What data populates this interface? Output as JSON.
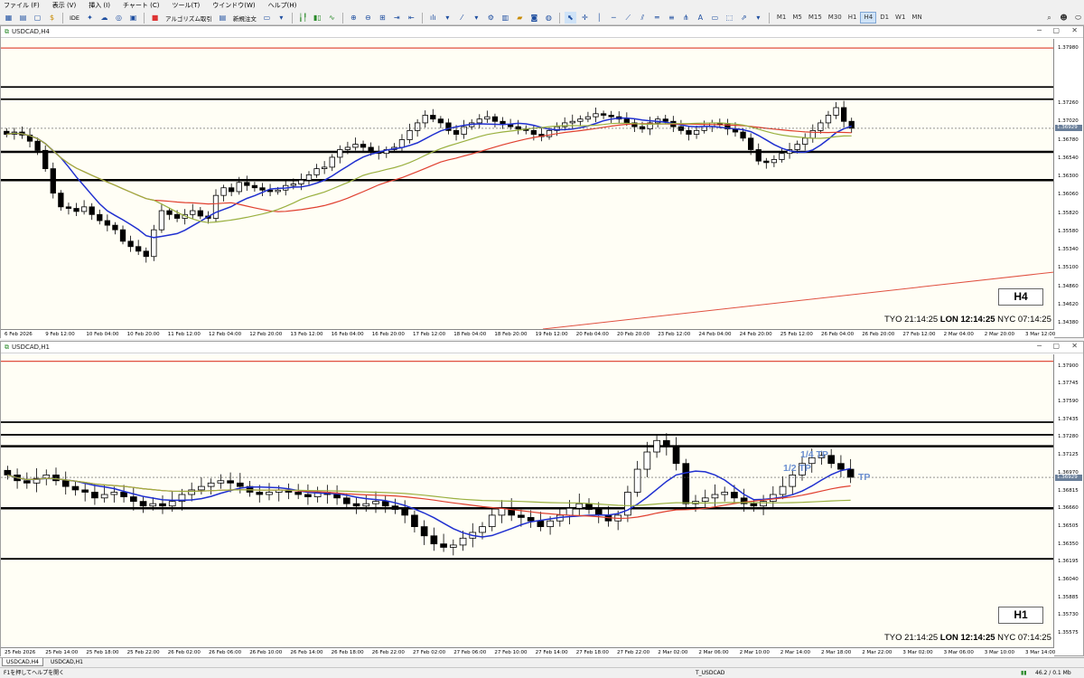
{
  "menu": {
    "items": [
      "ファイル (F)",
      "表示 (V)",
      "挿入 (I)",
      "チャート (C)",
      "ツール(T)",
      "ウインドウ(W)",
      "ヘルプ(H)"
    ]
  },
  "toolbar": {
    "ide": "IDE",
    "algo_label": "アルゴリズム取引",
    "new_order_label": "新規注文",
    "timeframes": [
      "M1",
      "M5",
      "M15",
      "M30",
      "H1",
      "H4",
      "D1",
      "W1",
      "MN"
    ],
    "active_timeframe": "H4"
  },
  "chart_h4": {
    "title": "USDCAD,H4",
    "timeframe_label": "H4",
    "current_price": "1.36929",
    "yticks": [
      "1.37980",
      "1.37260",
      "1.37020",
      "1.36780",
      "1.36540",
      "1.36300",
      "1.36060",
      "1.35820",
      "1.35580",
      "1.35340",
      "1.35100",
      "1.34860",
      "1.34620",
      "1.34380"
    ],
    "xticks": [
      "6 Feb 2026",
      "9 Feb 12:00",
      "10 Feb 04:00",
      "10 Feb 20:00",
      "11 Feb 12:00",
      "12 Feb 04:00",
      "12 Feb 20:00",
      "13 Feb 12:00",
      "16 Feb 04:00",
      "16 Feb 20:00",
      "17 Feb 12:00",
      "18 Feb 04:00",
      "18 Feb 20:00",
      "19 Feb 12:00",
      "20 Feb 04:00",
      "20 Feb 20:00",
      "23 Feb 12:00",
      "24 Feb 04:00",
      "24 Feb 20:00",
      "25 Feb 12:00",
      "26 Feb 04:00",
      "26 Feb 20:00",
      "27 Feb 12:00",
      "2 Mar 04:00",
      "2 Mar 20:00",
      "3 Mar 12:00"
    ],
    "clock": {
      "tyo": "TYO 21:14:25",
      "lon": "LON 12:14:25",
      "nyc": "NYC 07:14:25"
    }
  },
  "chart_h1": {
    "title": "USDCAD,H1",
    "timeframe_label": "H1",
    "current_price": "1.36929",
    "yticks": [
      "1.37900",
      "1.37745",
      "1.37590",
      "1.37435",
      "1.37280",
      "1.37125",
      "1.36970",
      "1.36815",
      "1.36660",
      "1.36505",
      "1.36350",
      "1.36195",
      "1.36040",
      "1.35885",
      "1.35730",
      "1.35575"
    ],
    "xticks": [
      "25 Feb 2026",
      "25 Feb 14:00",
      "25 Feb 18:00",
      "25 Feb 22:00",
      "26 Feb 02:00",
      "26 Feb 06:00",
      "26 Feb 10:00",
      "26 Feb 14:00",
      "26 Feb 18:00",
      "26 Feb 22:00",
      "27 Feb 02:00",
      "27 Feb 06:00",
      "27 Feb 10:00",
      "27 Feb 14:00",
      "27 Feb 18:00",
      "27 Feb 22:00",
      "2 Mar 02:00",
      "2 Mar 06:00",
      "2 Mar 10:00",
      "2 Mar 14:00",
      "2 Mar 18:00",
      "2 Mar 22:00",
      "3 Mar 02:00",
      "3 Mar 06:00",
      "3 Mar 10:00",
      "3 Mar 14:00"
    ],
    "labels": {
      "q": "1/4 TP",
      "h": "1/2 TP",
      "tp": "TP"
    },
    "clock": {
      "tyo": "TYO 21:14:25",
      "lon": "LON 12:14:25",
      "nyc": "NYC 07:14:25"
    }
  },
  "tabs": [
    "USDCAD,H4",
    "USDCAD,H1"
  ],
  "status": {
    "help": "F1を押してヘルプを開く",
    "profile": "T_USDCAD",
    "traffic": "46.2 / 0.1 Mb"
  },
  "chart_data": [
    {
      "type": "candlestick",
      "symbol": "USDCAD",
      "timeframe": "H4",
      "ylim": [
        1.343,
        1.381
      ],
      "horizontal_levels": [
        1.3798,
        1.3747,
        1.3731,
        1.3662,
        1.3625
      ],
      "closes": [
        1.3685,
        1.3688,
        1.3684,
        1.3676,
        1.3664,
        1.364,
        1.3608,
        1.359,
        1.3588,
        1.3584,
        1.359,
        1.358,
        1.3572,
        1.3566,
        1.356,
        1.3545,
        1.3538,
        1.3532,
        1.3525,
        1.356,
        1.3585,
        1.358,
        1.3575,
        1.358,
        1.3585,
        1.3578,
        1.3575,
        1.3605,
        1.3615,
        1.361,
        1.3622,
        1.3618,
        1.3615,
        1.3612,
        1.361,
        1.3612,
        1.3618,
        1.362,
        1.3625,
        1.3632,
        1.364,
        1.3642,
        1.3655,
        1.3665,
        1.3668,
        1.3672,
        1.3668,
        1.3662,
        1.366,
        1.3665,
        1.3668,
        1.3678,
        1.369,
        1.37,
        1.371,
        1.3705,
        1.37,
        1.369,
        1.3685,
        1.3695,
        1.37,
        1.3705,
        1.3708,
        1.3702,
        1.3698,
        1.3695,
        1.3692,
        1.369,
        1.3685,
        1.3682,
        1.369,
        1.3695,
        1.37,
        1.3702,
        1.3705,
        1.3708,
        1.3712,
        1.371,
        1.3708,
        1.3705,
        1.37,
        1.3695,
        1.3692,
        1.37,
        1.3705,
        1.3702,
        1.3695,
        1.369,
        1.3685,
        1.369,
        1.3695,
        1.37,
        1.3698,
        1.3692,
        1.3688,
        1.368,
        1.3665,
        1.365,
        1.3648,
        1.3652,
        1.366,
        1.3665,
        1.3672,
        1.368,
        1.369,
        1.37,
        1.371,
        1.372,
        1.3702,
        1.3693
      ]
    },
    {
      "type": "candlestick",
      "symbol": "USDCAD",
      "timeframe": "H1",
      "ylim": [
        1.3545,
        1.38
      ],
      "horizontal_levels": [
        1.3794,
        1.3741,
        1.373,
        1.372,
        1.3666,
        1.3622
      ],
      "closes": [
        1.3695,
        1.369,
        1.3688,
        1.3692,
        1.3695,
        1.369,
        1.3685,
        1.3682,
        1.368,
        1.3675,
        1.3678,
        1.368,
        1.3676,
        1.3672,
        1.3668,
        1.367,
        1.3668,
        1.3672,
        1.3678,
        1.3682,
        1.3685,
        1.3688,
        1.369,
        1.3688,
        1.3685,
        1.368,
        1.3678,
        1.368,
        1.3682,
        1.368,
        1.3678,
        1.3676,
        1.368,
        1.3678,
        1.3675,
        1.367,
        1.3668,
        1.367,
        1.3672,
        1.3668,
        1.3665,
        1.366,
        1.365,
        1.3642,
        1.3635,
        1.3632,
        1.3634,
        1.364,
        1.3645,
        1.365,
        1.366,
        1.3666,
        1.366,
        1.3658,
        1.3655,
        1.365,
        1.3655,
        1.366,
        1.3666,
        1.367,
        1.3665,
        1.366,
        1.3655,
        1.366,
        1.368,
        1.37,
        1.3715,
        1.3725,
        1.372,
        1.3705,
        1.367,
        1.3672,
        1.3675,
        1.3678,
        1.368,
        1.3675,
        1.367,
        1.3668,
        1.3672,
        1.3678,
        1.3685,
        1.3695,
        1.3705,
        1.371,
        1.3712,
        1.3705,
        1.37,
        1.3693
      ]
    }
  ]
}
